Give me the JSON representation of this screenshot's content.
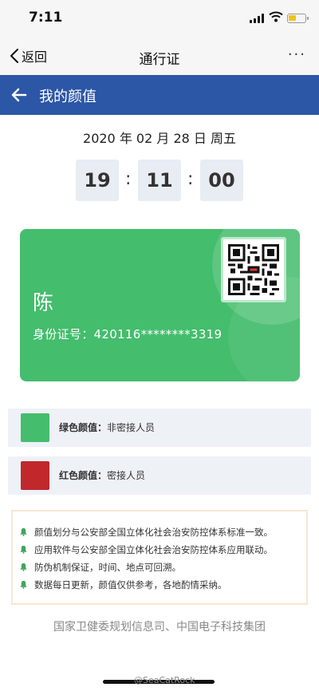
{
  "status_bar": {
    "time": "7:11"
  },
  "nav": {
    "back_label": "返回",
    "title": "通行证",
    "more": "···"
  },
  "header": {
    "title": "我的颜值"
  },
  "date": {
    "text": "2020 年 02 月 28 日 周五"
  },
  "clock": {
    "hours": "19",
    "minutes": "11",
    "seconds": "00",
    "separator": ":"
  },
  "card": {
    "name": "陈",
    "id_label": "身份证号：",
    "id_value": "420116********3319",
    "color": "#44bd6d"
  },
  "legend": [
    {
      "label": "绿色颜值：",
      "desc": "非密接人员",
      "color": "#44bd6d"
    },
    {
      "label": "红色颜值：",
      "desc": "密接人员",
      "color": "#c0282c"
    }
  ],
  "notices": [
    "颜值划分与公安部全国立体化社会治安防控体系标准一致。",
    "应用软件与公安部全国立体化社会治安防控体系应用联动。",
    "防伪机制保证，时间、地点可回溯。",
    "数据每日更新，颜值仅供参考，各地酌情采纳。"
  ],
  "footer": {
    "org": "国家卫健委规划信息司、中国电子科技集团"
  },
  "watermark": "@SeaCatRock",
  "colors": {
    "header_blue": "#2c56a6",
    "notice_icon": "#3fa45c",
    "battery": "#f2c21b"
  },
  "icons": [
    "back-chevron-icon",
    "back-arrow-icon",
    "bell-icon",
    "qr-code-icon",
    "wifi-icon",
    "signal-icon",
    "battery-icon"
  ]
}
